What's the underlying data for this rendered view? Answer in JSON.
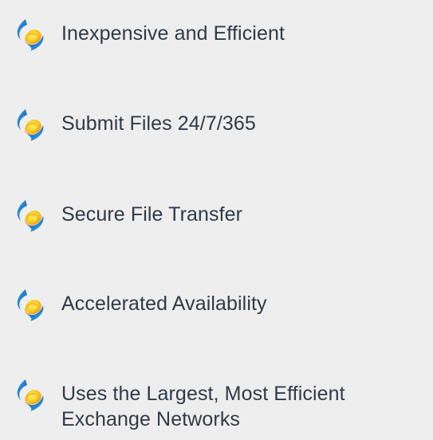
{
  "features": [
    {
      "icon": "orbit-sun-icon",
      "label": "Inexpensive and Efficient"
    },
    {
      "icon": "orbit-sun-icon",
      "label": "Submit Files 24/7/365"
    },
    {
      "icon": "orbit-sun-icon",
      "label": "Secure File Transfer"
    },
    {
      "icon": "orbit-sun-icon",
      "label": "Accelerated Availability"
    },
    {
      "icon": "orbit-sun-icon",
      "label": "Uses the Largest, Most Efficient Exchange Networks"
    }
  ],
  "colors": {
    "background": "#efeeee",
    "text": "#2f3a49",
    "icon_blue": "#1f4fa6",
    "icon_light_blue": "#2aa6e8",
    "icon_yellow": "#f6d11e",
    "icon_orange": "#f39a1a"
  }
}
